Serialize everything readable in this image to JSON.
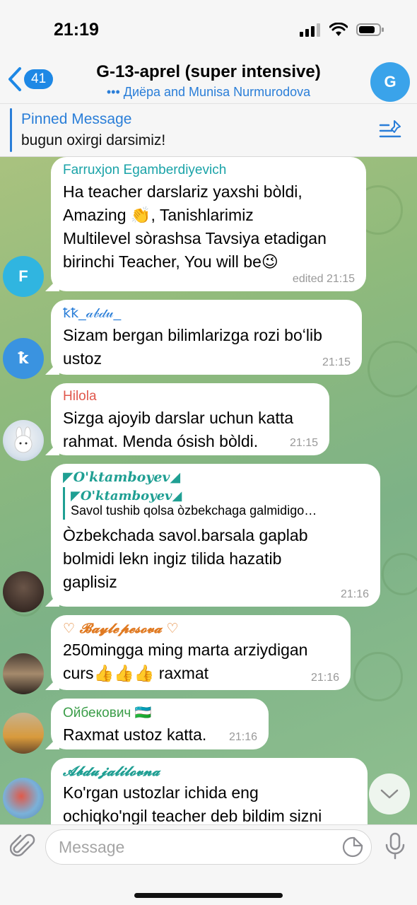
{
  "status": {
    "time": "21:19"
  },
  "header": {
    "back_count": "41",
    "title": "G-13-aprel (super intensive)",
    "typing": "••• Диёра and Munisa Nurmurodova",
    "avatar_letter": "G",
    "avatar_color": "#3aa3ea"
  },
  "pinned": {
    "title": "Pinned Message",
    "text": "bugun oxirgi darsimiz!"
  },
  "messages": [
    {
      "sender": "Farruxjon Egamberdiyevich",
      "sender_color": "#1aa3a8",
      "text_lines": [
        "Ha teacher darslariz yaxshi bòldi,",
        "Amazing 👏,  Tanishlarimiz",
        "Multilevel sòrashsa Tavsiya etadigan",
        "birinchi Teacher, You will be😉"
      ],
      "meta": "edited 21:15",
      "avatar_letter": "F"
    },
    {
      "sender": "ꝁꝁ_𝒶𝒷𝒹𝓊_",
      "sender_color": "#2a7ed8",
      "text_lines": [
        "Sizam bergan bilimlarizga rozi boʻlib",
        "ustoz"
      ],
      "meta": "21:15",
      "avatar_letter": "ꝁ"
    },
    {
      "sender": "Hilola",
      "sender_color": "#e0574c",
      "text_lines": [
        "Sizga ajoyib darslar uchun katta",
        "rahmat. Menda ósish bòldi."
      ],
      "meta": "21:15"
    },
    {
      "sender": "◤O'ktamboyev◢",
      "sender_color": "#1f9f93",
      "reply_name": "◤O'ktamboyev◢",
      "reply_text": "Savol tushib qolsa òzbekchaga galmidigo…",
      "text_lines": [
        "Òzbekchada savol.barsala gaplab",
        "bolmidi lekn ingiz tilida hazatib",
        "gaplisiz"
      ],
      "meta": "21:16"
    },
    {
      "sender": "♡ 𝓑𝓪𝔂𝓵𝓮𝓹𝓮𝓼𝓸𝓿𝓪 ♡",
      "sender_color": "#e07a22",
      "text_lines": [
        "250mingga ming marta arziydigan",
        "curs👍👍👍 raxmat"
      ],
      "meta": "21:16"
    },
    {
      "sender": "Ойбекович 🇺🇿",
      "sender_color": "#3a9d48",
      "text_lines": [
        "Raxmat ustoz katta."
      ],
      "meta": "21:16"
    },
    {
      "sender": "𝓐𝓫𝓭𝓾𝓳𝓪𝓵𝓲𝓵𝓸𝓿𝓷𝓪",
      "sender_color": "#1f9f93",
      "text_lines": [
        "Ko'rgan ustozlar ichida eng",
        "ochiqko'ngil teacher deb bildim sizni"
      ],
      "meta": ""
    }
  ],
  "input": {
    "placeholder": "Message"
  },
  "colors": {
    "accent": "#2a7ed8",
    "chat_bg": "#8fba7c"
  }
}
